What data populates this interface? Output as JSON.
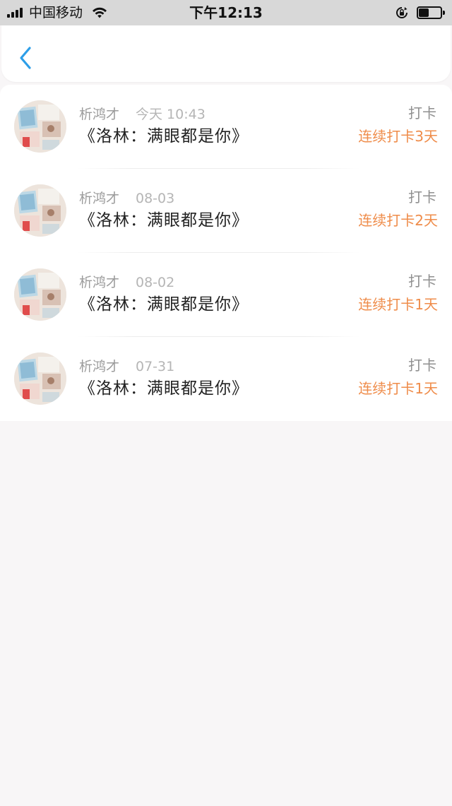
{
  "status_bar": {
    "carrier": "中国移动",
    "time": "下午12:13",
    "battery_level": 0.5
  },
  "nav": {
    "back_icon": "chevron-left-icon",
    "accent_color": "#2d9ee8"
  },
  "colors": {
    "streak": "#ef8c4a",
    "name": "#9b9b9b",
    "title": "#222222"
  },
  "records": [
    {
      "name": "析鸿才",
      "date": "今天 10:43",
      "title": "《洛林：满眼都是你》",
      "type": "打卡",
      "streak": "连续打卡3天"
    },
    {
      "name": "析鸿才",
      "date": "08-03",
      "title": "《洛林：满眼都是你》",
      "type": "打卡",
      "streak": "连续打卡2天"
    },
    {
      "name": "析鸿才",
      "date": "08-02",
      "title": "《洛林：满眼都是你》",
      "type": "打卡",
      "streak": "连续打卡1天"
    },
    {
      "name": "析鸿才",
      "date": "07-31",
      "title": "《洛林：满眼都是你》",
      "type": "打卡",
      "streak": "连续打卡1天"
    }
  ]
}
